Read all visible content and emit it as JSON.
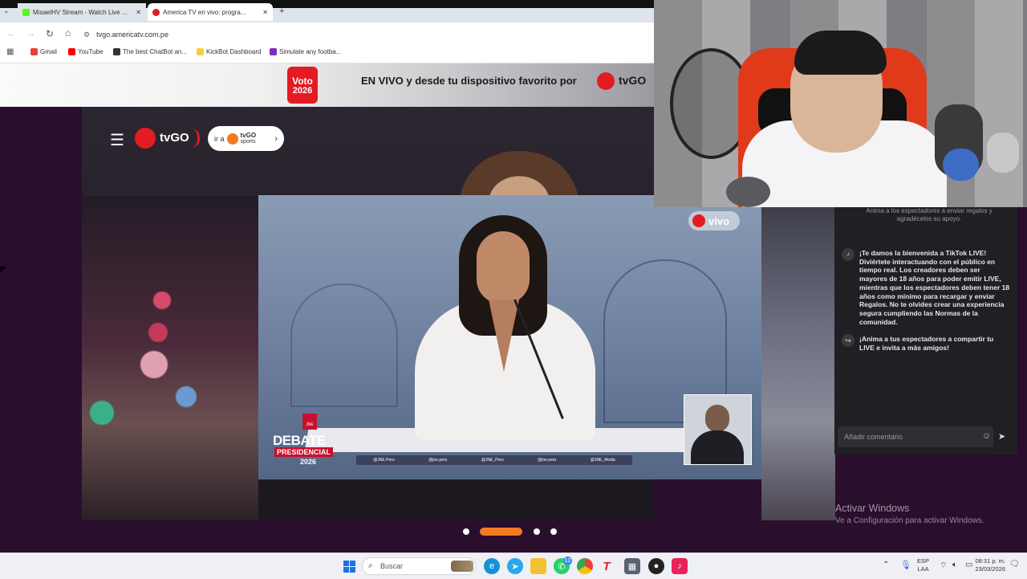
{
  "browser": {
    "tabs": [
      {
        "title": "MisaelHV Stream - Watch Live ..."
      },
      {
        "title": "America TV en vivo: progra..."
      }
    ],
    "new_tab_symbol": "+",
    "address": "tvgo.americatv.com.pe",
    "bookmarks": [
      {
        "label": "Gmail",
        "color": "#ea4335"
      },
      {
        "label": "YouTube",
        "color": "#ff0000"
      },
      {
        "label": "The best ChatBot an...",
        "color": "#333333"
      },
      {
        "label": "KickBot Dashboard",
        "color": "#f4d03f"
      },
      {
        "label": "Simulate any footba...",
        "color": "#7b2fbe"
      }
    ]
  },
  "banner": {
    "badge_line1": "Voto",
    "badge_line2": "2026",
    "text": "EN VIVO y desde tu dispositivo favorito por",
    "brand": "tvGO"
  },
  "site": {
    "logo": "tvGO",
    "sports_prefix": "ir a",
    "sports_brand": "tvGO",
    "sports_sub": "sports",
    "vivo_badge": "vivo"
  },
  "video_overlay": {
    "debate": "DEBATE",
    "presidencial": "PRESIDENCIAL",
    "year": "2026",
    "jne": "JNE",
    "socials": [
      "@JNE.Peru",
      "@jne.peru",
      "@JNE_Peru",
      "@jne.peru",
      "@JNE_Media"
    ]
  },
  "carousel": {
    "active_index": 1,
    "count": 4
  },
  "chat": {
    "partial_top": "Anima a los espectadores a enviar regalos y agradécelos su apoyo.",
    "welcome": "¡Te damos la bienvenida a TikTok LIVE! Diviértete interactuando con el público en tiempo real. Los creadores deben ser mayores de 18 años para poder emitir LIVE, mientras que los espectadores deben tener 18 años como mínimo para recargar y enviar Regalos. No te olvides crear una experiencia segura cumpliendo las Normas de la comunidad.",
    "share": "¡Anima a tus espectadores a compartir tu LIVE e invita a más amigos!",
    "input_placeholder": "Añadir comentario"
  },
  "windows_watermark": {
    "title": "Activar Windows",
    "subtitle": "Ve a Configuración para activar Windows."
  },
  "taskbar": {
    "search_placeholder": "Buscar",
    "whatsapp_badge": "12",
    "language_line1": "ESP",
    "language_line2": "LAA",
    "time": "08:31 p. m.",
    "date": "23/03/2026"
  },
  "colors": {
    "accent_orange": "#f47a20",
    "tvgo_red": "#e31b23",
    "page_bg": "#2a0e2e"
  }
}
